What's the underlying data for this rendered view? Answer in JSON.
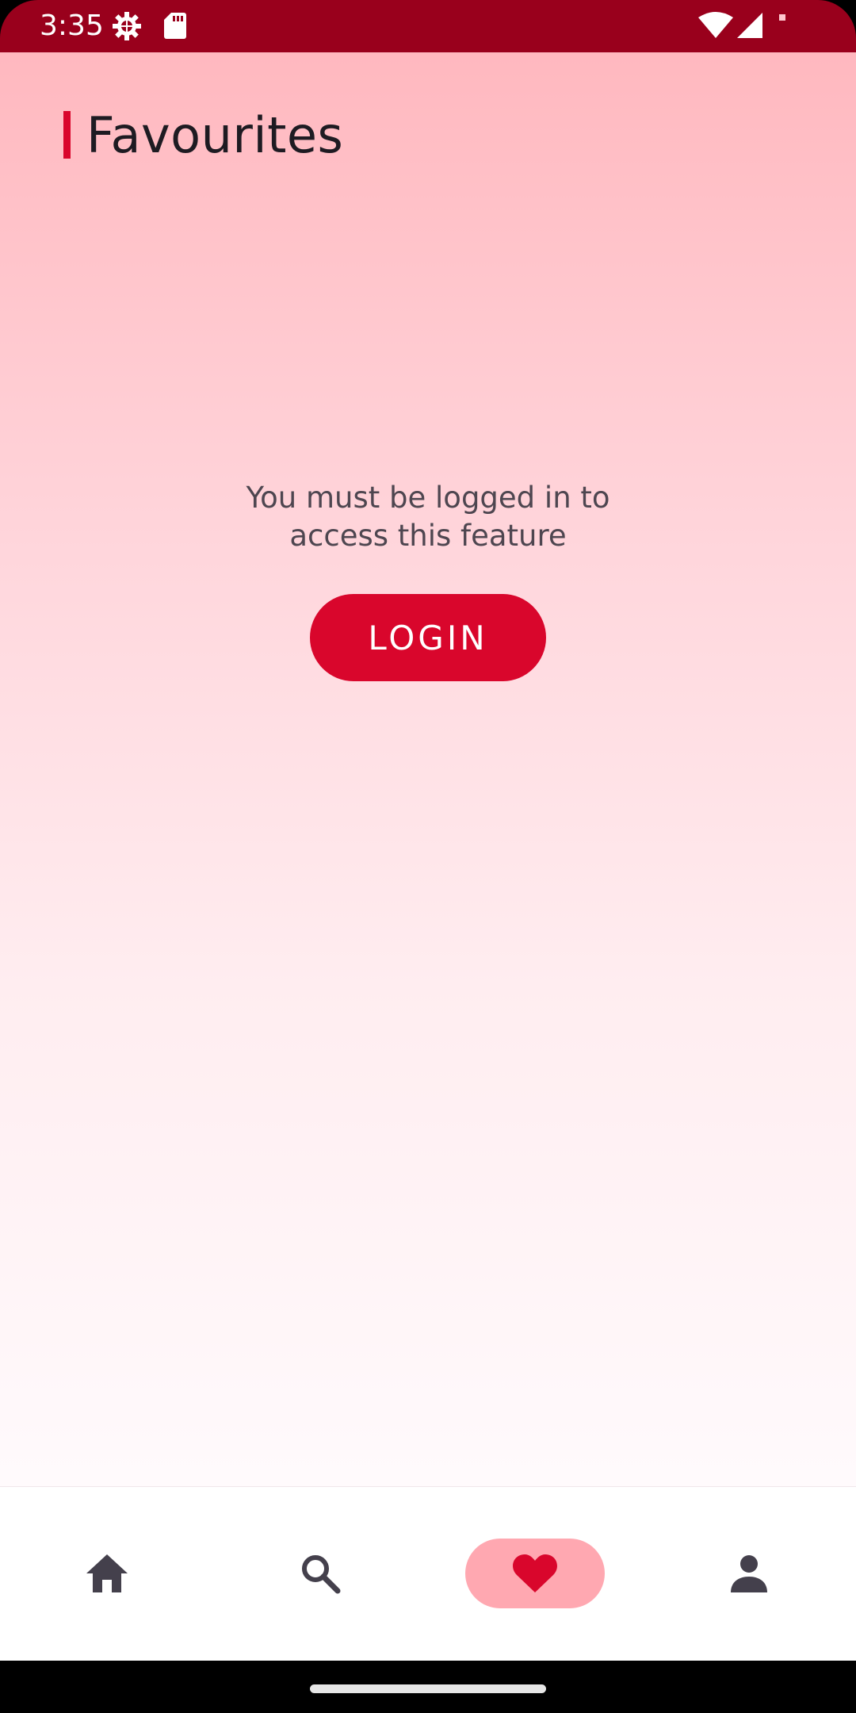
{
  "status_bar": {
    "time": "3:35",
    "icons_left": [
      "settings-gear-icon",
      "sd-card-icon"
    ],
    "icons_right": [
      "wifi-icon",
      "cell-signal-icon",
      "notification-dot-icon"
    ],
    "background": "#99001c"
  },
  "header": {
    "title": "Favourites",
    "accent_color": "#d9062c"
  },
  "main": {
    "message_line1": "You must be logged in to",
    "message_line2": "access this feature",
    "login_label": "LOGIN",
    "button_color": "#d9062c"
  },
  "bottom_nav": {
    "items": [
      {
        "id": "home",
        "icon": "home-icon",
        "active": false
      },
      {
        "id": "search",
        "icon": "search-icon",
        "active": false
      },
      {
        "id": "favourites",
        "icon": "heart-icon",
        "active": true
      },
      {
        "id": "profile",
        "icon": "person-icon",
        "active": false
      }
    ],
    "active_pill_color": "#ffa8b1",
    "active_icon_color": "#d9062c",
    "icon_color": "#44404c"
  }
}
